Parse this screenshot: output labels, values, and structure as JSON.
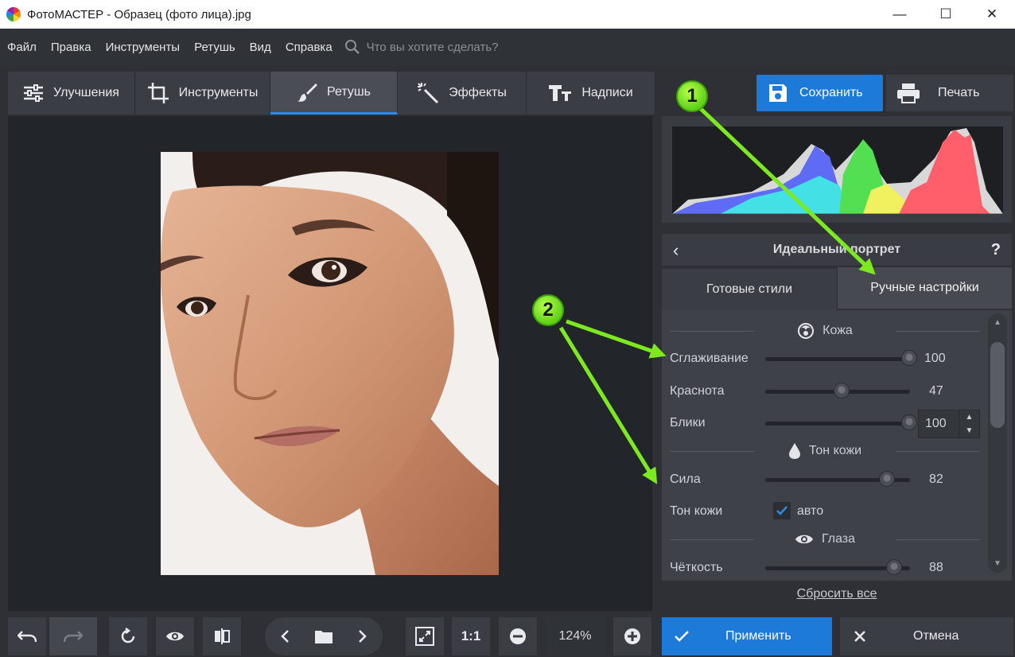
{
  "window": {
    "title": "ФотоМАСТЕР - Образец (фото лица).jpg",
    "minimize": "—",
    "maximize": "☐",
    "close": "✕"
  },
  "menu": {
    "items": [
      "Файл",
      "Правка",
      "Инструменты",
      "Ретушь",
      "Вид",
      "Справка"
    ],
    "search_placeholder": "Что вы хотите сделать?"
  },
  "tabs": [
    {
      "label": "Улучшения",
      "icon": "sliders-icon"
    },
    {
      "label": "Инструменты",
      "icon": "crop-icon"
    },
    {
      "label": "Ретушь",
      "icon": "brush-icon",
      "active": true
    },
    {
      "label": "Эффекты",
      "icon": "magic-wand-icon"
    },
    {
      "label": "Надписи",
      "icon": "text-icon"
    }
  ],
  "actions": {
    "save": "Сохранить",
    "print": "Печать"
  },
  "panel": {
    "title": "Идеальный портрет",
    "help": "?",
    "subtabs": {
      "styles": "Готовые стили",
      "manual": "Ручные настройки"
    },
    "sections": {
      "skin": "Кожа",
      "skin_tone": "Тон кожи",
      "eyes": "Глаза"
    },
    "sliders": [
      {
        "label": "Сглаживание",
        "value": "100",
        "fraction": 1.0
      },
      {
        "label": "Краснота",
        "value": "47",
        "fraction": 0.47
      },
      {
        "label": "Блики",
        "value": "100",
        "fraction": 1.0
      },
      {
        "label": "Сила",
        "value": "82",
        "fraction": 0.82
      },
      {
        "label": "Чёткость",
        "value": "88",
        "fraction": 0.88
      }
    ],
    "skin_tone_row": {
      "label": "Тон кожи",
      "checkbox_label": "авто",
      "checked": true
    },
    "reset": "Сбросить все"
  },
  "bottom": {
    "zoom": "124%",
    "one_to_one": "1:1",
    "apply": "Применить",
    "cancel": "Отмена"
  },
  "annotations": {
    "badge1": "1",
    "badge2": "2",
    "color": "#7dea1f"
  },
  "colors": {
    "accent": "#1e7ad8",
    "panel": "#3e4147",
    "background": "#2e3035"
  }
}
